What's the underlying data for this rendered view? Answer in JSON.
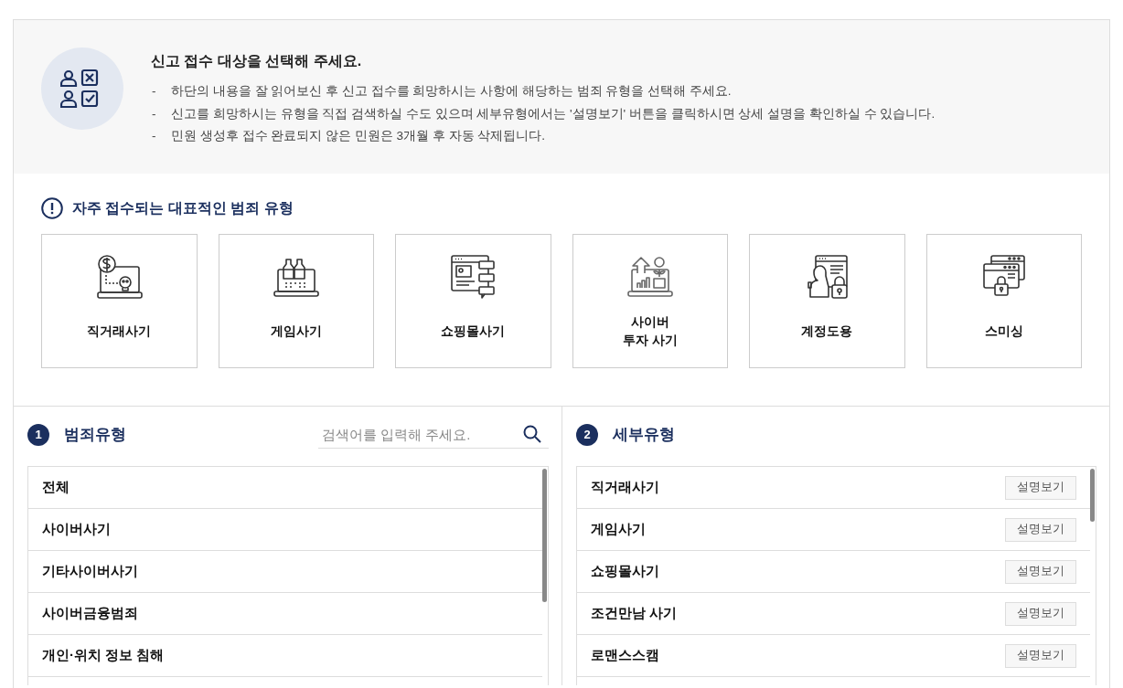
{
  "intro": {
    "title": "신고 접수 대상을 선택해 주세요.",
    "notes": [
      {
        "bullet": "-",
        "text": "하단의 내용을 잘 읽어보신 후 신고 접수를 희망하시는 사항에 해당하는 범죄 유형을 선택해 주세요."
      },
      {
        "bullet": "-",
        "text": "신고를 희망하시는 유형을 직접 검색하실 수도 있으며 세부유형에서는 '설명보기' 버튼을 클릭하시면 상세 설명을 확인하실 수 있습니다."
      },
      {
        "bullet": "-",
        "text": "민원 생성후 접수 완료되지 않은 민원은 3개월 후 자동 삭제됩니다."
      }
    ]
  },
  "popular": {
    "title": "자주 접수되는 대표적인 범죄 유형",
    "items": [
      {
        "label": "직거래사기",
        "kind": "money"
      },
      {
        "label": "게임사기",
        "kind": "game"
      },
      {
        "label": "쇼핑몰사기",
        "kind": "shop"
      },
      {
        "label": "사이버\n투자 사기",
        "kind": "invest"
      },
      {
        "label": "계정도용",
        "kind": "account"
      },
      {
        "label": "스미싱",
        "kind": "smishing"
      }
    ]
  },
  "crime_types": {
    "number": "1",
    "title": "범죄유형",
    "search": {
      "placeholder": "검색어를 입력해 주세요."
    },
    "items": [
      "전체",
      "사이버사기",
      "기타사이버사기",
      "사이버금융범죄",
      "개인·위치 정보 침해"
    ]
  },
  "subtypes": {
    "number": "2",
    "title": "세부유형",
    "items": [
      {
        "label": "직거래사기",
        "button": "설명보기"
      },
      {
        "label": "게임사기",
        "button": "설명보기"
      },
      {
        "label": "쇼핑몰사기",
        "button": "설명보기"
      },
      {
        "label": "조건만남 사기",
        "button": "설명보기"
      },
      {
        "label": "로맨스스캠",
        "button": "설명보기"
      }
    ]
  }
}
